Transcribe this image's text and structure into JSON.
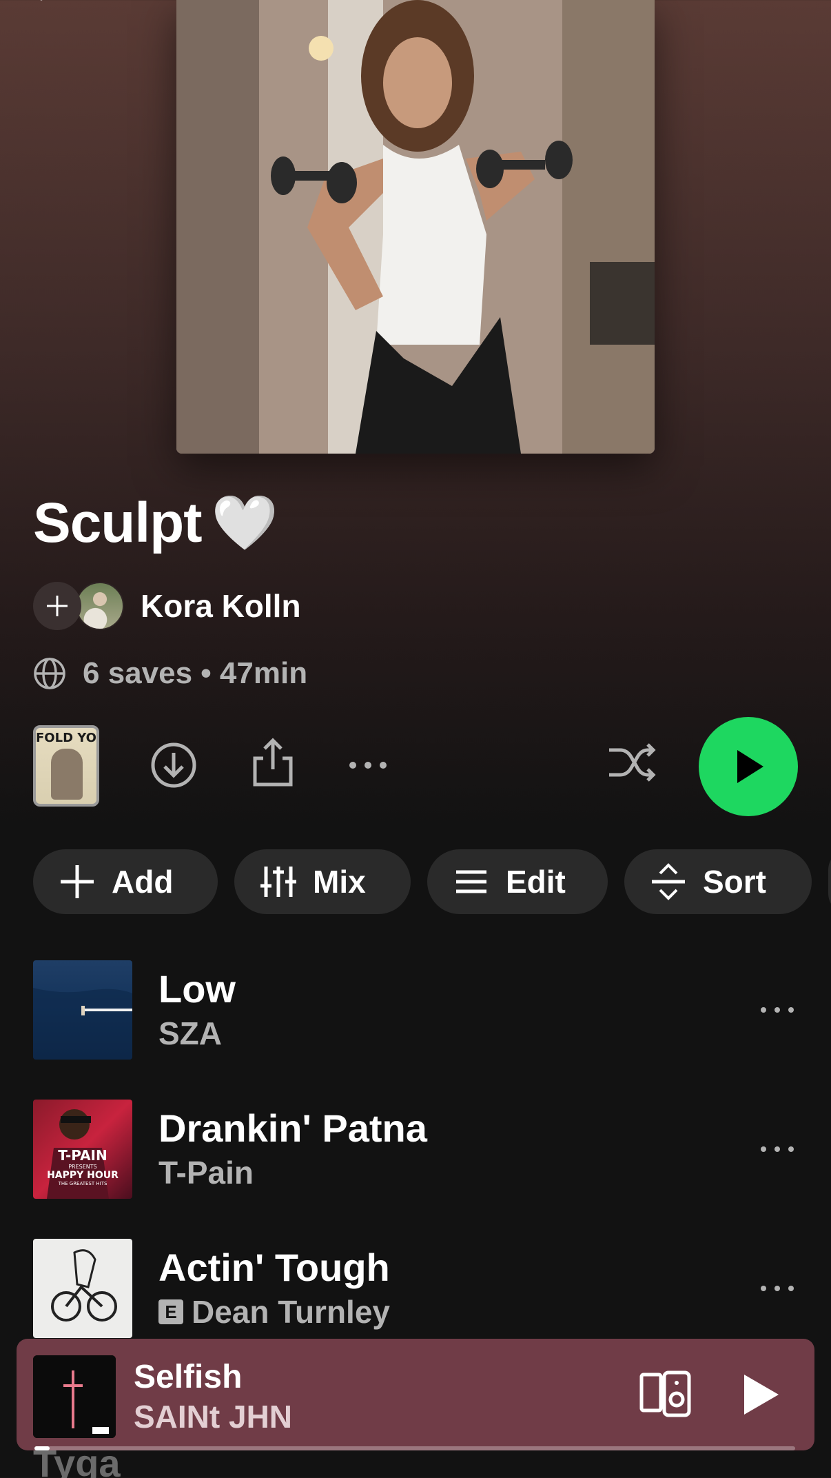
{
  "playlist": {
    "title": "Sculpt",
    "title_emoji": "🤍",
    "owner": "Kora Kolln",
    "stats": "6 saves • 47min"
  },
  "thumbnail_text": "FOLD YO",
  "chips": {
    "add": "Add",
    "mix": "Mix",
    "edit": "Edit",
    "sort": "Sort"
  },
  "tracks": [
    {
      "name": "Low",
      "artist": "SZA",
      "explicit": false
    },
    {
      "name": "Drankin' Patna",
      "artist": "T-Pain",
      "explicit": false
    },
    {
      "name": "Actin' Tough",
      "artist": "Dean Turnley",
      "explicit": true,
      "explicit_label": "E"
    }
  ],
  "partial_track": {
    "artist": "Tyga"
  },
  "tpain_art_text": {
    "line1": "T-PAIN",
    "line2": "PRESENTS",
    "line3": "HAPPY HOUR",
    "line4": "THE GREATEST HITS"
  },
  "now_playing": {
    "title": "Selfish",
    "artist": "SAINt JHN",
    "progress": 0.02
  },
  "colors": {
    "accent_green": "#1ed760",
    "player_bg": "#703c47",
    "background": "#121212"
  },
  "icons": [
    "back-icon",
    "plus-icon",
    "globe-icon",
    "download-icon",
    "share-icon",
    "more-icon",
    "shuffle-icon",
    "play-icon",
    "mix-icon",
    "edit-icon",
    "sort-icon",
    "device-icon"
  ]
}
